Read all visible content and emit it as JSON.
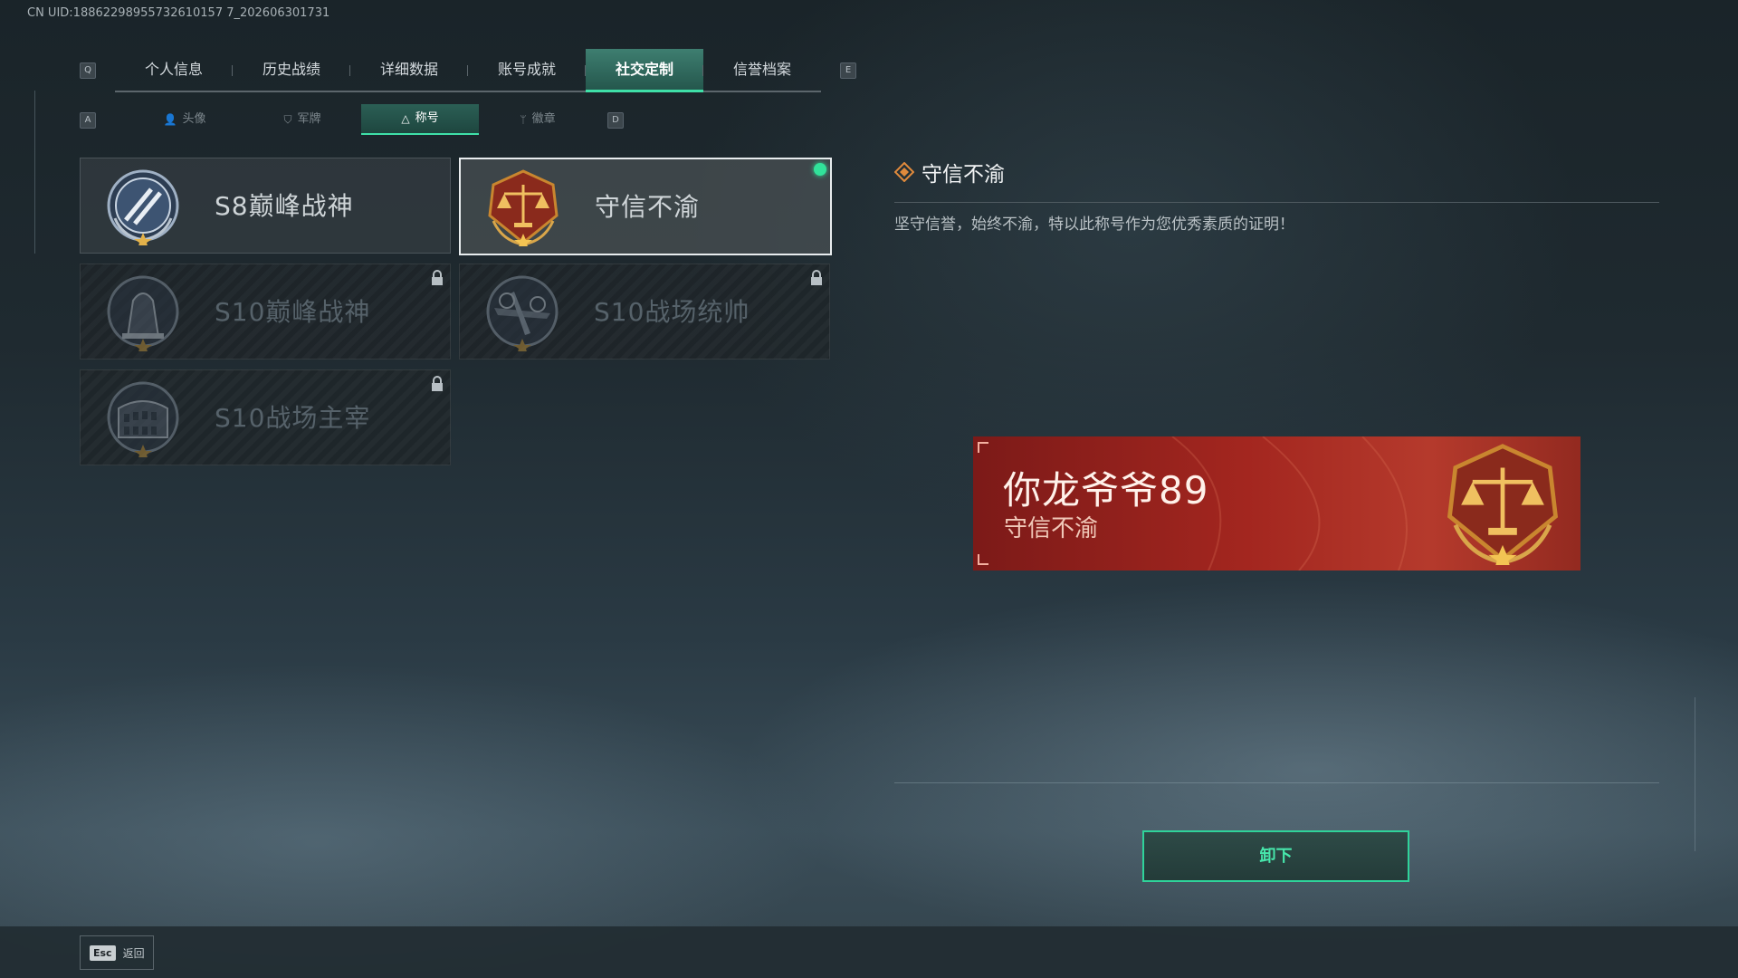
{
  "uid_text": "CN UID:18862298955732610157 7_202606301731",
  "nav_tabs": {
    "prev_key": "Q",
    "next_key": "E",
    "items": [
      {
        "label": "个人信息",
        "active": false
      },
      {
        "label": "历史战绩",
        "active": false
      },
      {
        "label": "详细数据",
        "active": false
      },
      {
        "label": "账号成就",
        "active": false
      },
      {
        "label": "社交定制",
        "active": true
      },
      {
        "label": "信誉档案",
        "active": false
      }
    ]
  },
  "sub_tabs": {
    "prev_key": "A",
    "next_key": "D",
    "items": [
      {
        "label": "头像",
        "icon": "person-icon",
        "active": false
      },
      {
        "label": "军牌",
        "icon": "badge-icon",
        "active": false
      },
      {
        "label": "称号",
        "icon": "triangle-icon",
        "active": true
      },
      {
        "label": "徽章",
        "icon": "wings-icon",
        "active": false
      }
    ]
  },
  "titles": [
    {
      "name": "S8巅峰战神",
      "emblem": "stripes-emblem",
      "locked": false,
      "selected": false,
      "equipped": false
    },
    {
      "name": "守信不渝",
      "emblem": "scales-emblem",
      "locked": false,
      "selected": true,
      "equipped": true
    },
    {
      "name": "S10巅峰战神",
      "emblem": "tower-emblem",
      "locked": true,
      "selected": false,
      "equipped": false
    },
    {
      "name": "S10战场统帅",
      "emblem": "plane-emblem",
      "locked": true,
      "selected": false,
      "equipped": false
    },
    {
      "name": "S10战场主宰",
      "emblem": "colosseum-emblem",
      "locked": true,
      "selected": false,
      "equipped": false
    }
  ],
  "detail": {
    "title": "守信不渝",
    "description": "坚守信誉，始终不渝，特以此称号作为您优秀素质的证明！"
  },
  "preview_banner": {
    "player_name": "你龙爷爷89",
    "title": "守信不渝"
  },
  "action_button": "卸下",
  "footer": {
    "esc_key": "Esc",
    "back_label": "返回"
  },
  "colors": {
    "accent": "#3fe0a8",
    "equipped_dot": "#31e29a",
    "banner_red": "#a3261f"
  }
}
